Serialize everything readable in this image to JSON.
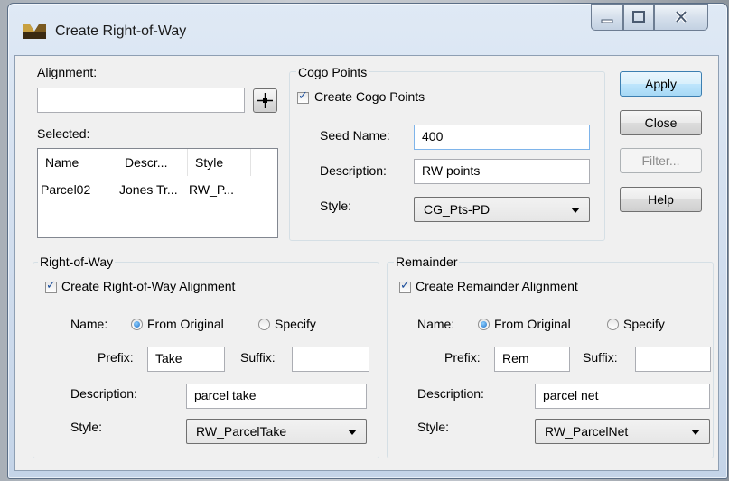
{
  "window": {
    "title": "Create Right-of-Way",
    "minimize_label": "–",
    "maximize_label": "□",
    "close_label": "X"
  },
  "alignment": {
    "label": "Alignment:",
    "value": "",
    "pick_icon": "crosshair-icon"
  },
  "selected": {
    "label": "Selected:",
    "columns": [
      "Name",
      "Descr...",
      "Style"
    ],
    "rows": [
      [
        "Parcel02",
        "Jones Tr...",
        "RW_P..."
      ]
    ]
  },
  "cogo": {
    "group_title": "Cogo Points",
    "checkbox_label": "Create Cogo Points",
    "checked": true,
    "seed_name_label": "Seed Name:",
    "seed_name_value": "400",
    "description_label": "Description:",
    "description_value": "RW points",
    "style_label": "Style:",
    "style_value": "CG_Pts-PD"
  },
  "buttons": {
    "apply": "Apply",
    "close": "Close",
    "filter": "Filter...",
    "help": "Help"
  },
  "right_of_way": {
    "group_title": "Right-of-Way",
    "checkbox_label": "Create Right-of-Way Alignment",
    "checked": true,
    "name_label": "Name:",
    "option_original": "From Original",
    "option_specify": "Specify",
    "selected_option": "From Original",
    "prefix_label": "Prefix:",
    "prefix_value": "Take_",
    "suffix_label": "Suffix:",
    "suffix_value": "",
    "description_label": "Description:",
    "description_value": "parcel take",
    "style_label": "Style:",
    "style_value": "RW_ParcelTake"
  },
  "remainder": {
    "group_title": "Remainder",
    "checkbox_label": "Create Remainder Alignment",
    "checked": true,
    "name_label": "Name:",
    "option_original": "From Original",
    "option_specify": "Specify",
    "selected_option": "From Original",
    "prefix_label": "Prefix:",
    "prefix_value": "Rem_",
    "suffix_label": "Suffix:",
    "suffix_value": "",
    "description_label": "Description:",
    "description_value": "parcel net",
    "style_label": "Style:",
    "style_value": "RW_ParcelNet"
  },
  "colors": {
    "client_bg": "#f0f0f0",
    "default_button": "#bee6fd",
    "radio_dot": "#1f6fc7",
    "check_mark": "#1c4f9c"
  }
}
